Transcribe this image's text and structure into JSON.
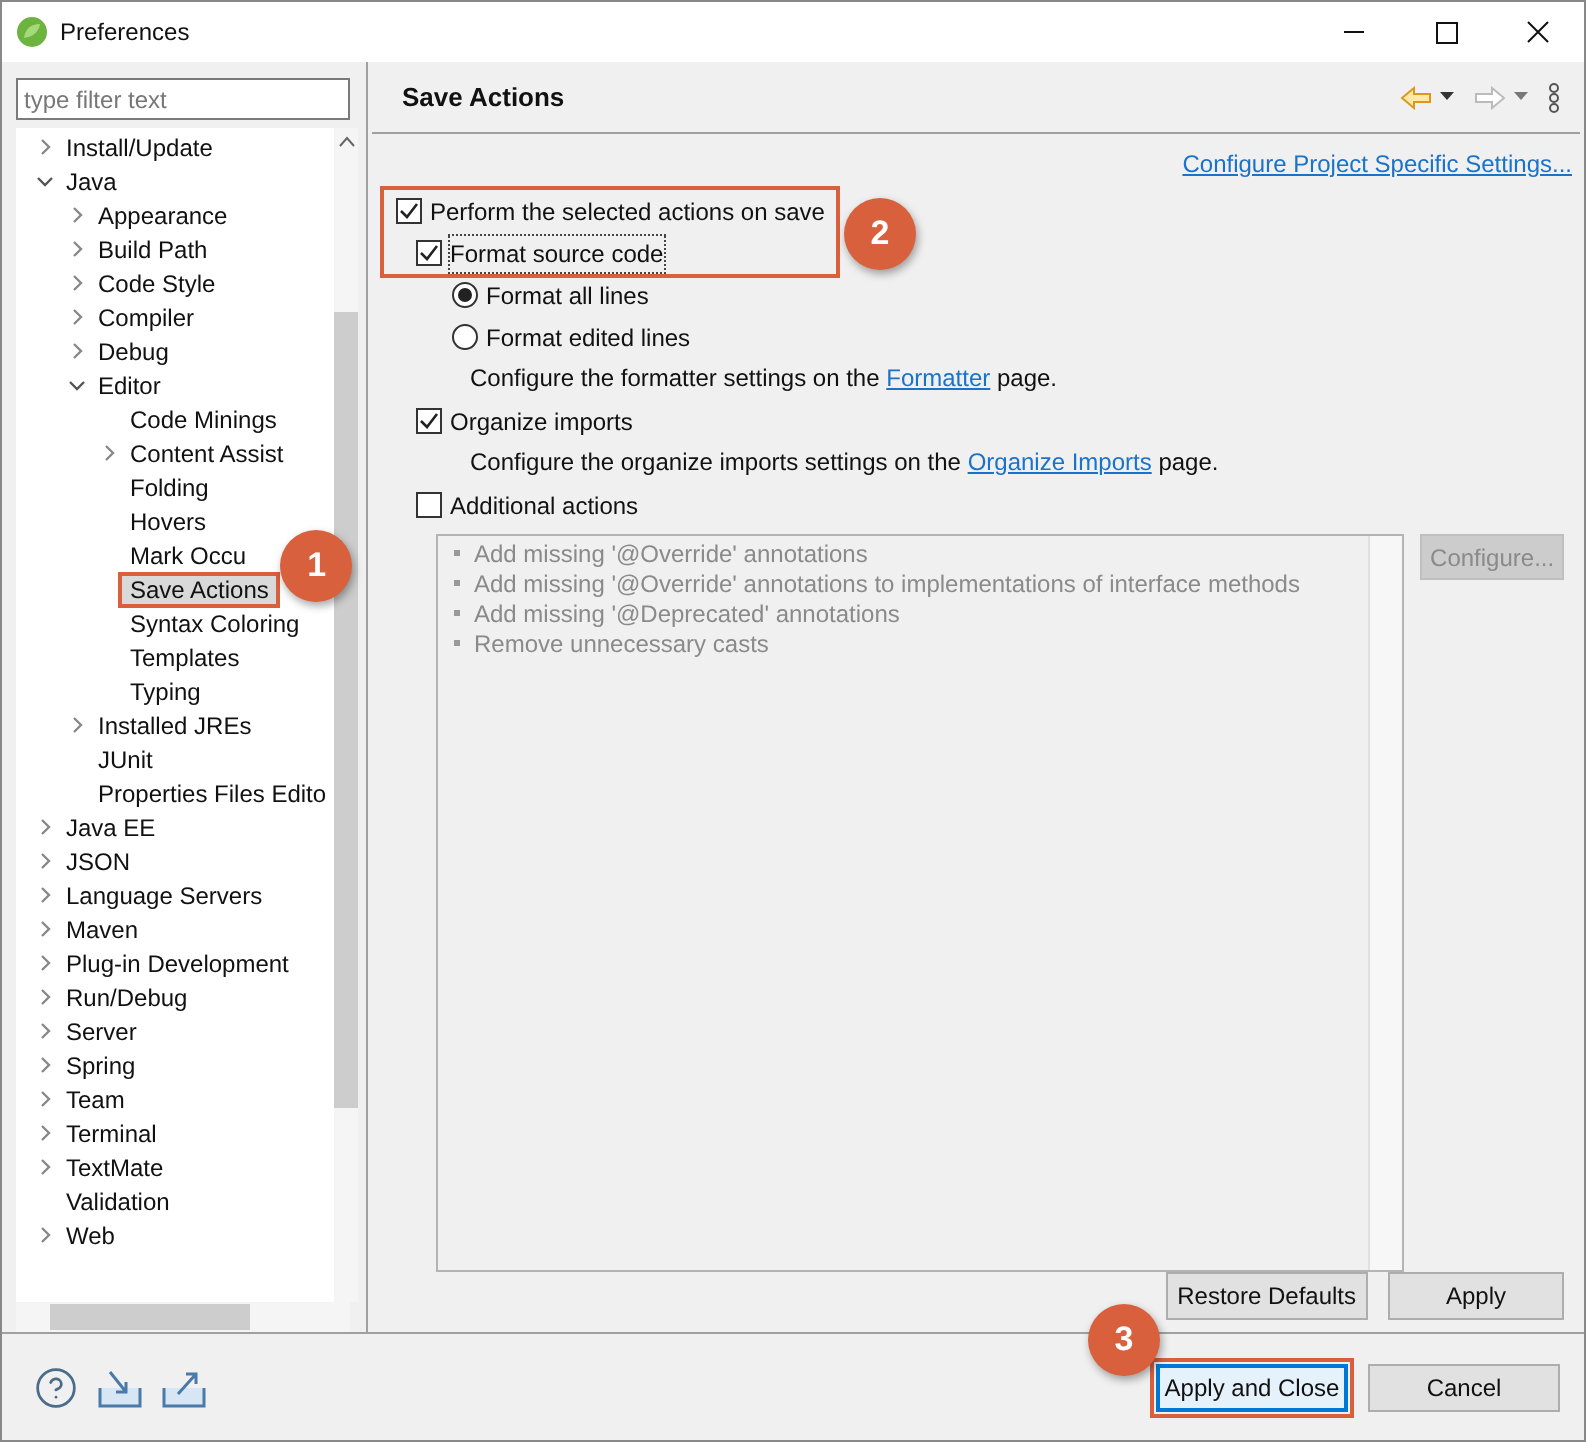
{
  "window": {
    "title": "Preferences"
  },
  "filter": {
    "placeholder": "type filter text"
  },
  "tree": [
    {
      "label": "Install/Update",
      "kind": "node",
      "expanded": false,
      "selected": false
    },
    {
      "label": "Java",
      "kind": "node",
      "expanded": true,
      "selected": false,
      "children": [
        {
          "label": "Appearance",
          "kind": "node",
          "expanded": false,
          "selected": false
        },
        {
          "label": "Build Path",
          "kind": "node",
          "expanded": false,
          "selected": false
        },
        {
          "label": "Code Style",
          "kind": "node",
          "expanded": false,
          "selected": false
        },
        {
          "label": "Compiler",
          "kind": "node",
          "expanded": false,
          "selected": false
        },
        {
          "label": "Debug",
          "kind": "node",
          "expanded": false,
          "selected": false
        },
        {
          "label": "Editor",
          "kind": "node",
          "expanded": true,
          "selected": false,
          "children": [
            {
              "label": "Code Minings",
              "kind": "leaf",
              "selected": false
            },
            {
              "label": "Content Assist",
              "kind": "node",
              "expanded": false,
              "selected": false
            },
            {
              "label": "Folding",
              "kind": "leaf",
              "selected": false
            },
            {
              "label": "Hovers",
              "kind": "leaf",
              "selected": false
            },
            {
              "label": "Mark Occu",
              "kind": "leaf",
              "selected": false
            },
            {
              "label": "Save Actions",
              "kind": "leaf",
              "selected": true,
              "callout": "1"
            },
            {
              "label": "Syntax Coloring",
              "kind": "leaf",
              "selected": false
            },
            {
              "label": "Templates",
              "kind": "leaf",
              "selected": false
            },
            {
              "label": "Typing",
              "kind": "leaf",
              "selected": false
            }
          ]
        },
        {
          "label": "Installed JREs",
          "kind": "node",
          "expanded": false,
          "selected": false
        },
        {
          "label": "JUnit",
          "kind": "leaf",
          "selected": false
        },
        {
          "label": "Properties Files Edito",
          "kind": "leaf",
          "selected": false
        }
      ]
    },
    {
      "label": "Java EE",
      "kind": "node",
      "expanded": false,
      "selected": false
    },
    {
      "label": "JSON",
      "kind": "node",
      "expanded": false,
      "selected": false
    },
    {
      "label": "Language Servers",
      "kind": "node",
      "expanded": false,
      "selected": false
    },
    {
      "label": "Maven",
      "kind": "node",
      "expanded": false,
      "selected": false
    },
    {
      "label": "Plug-in Development",
      "kind": "node",
      "expanded": false,
      "selected": false
    },
    {
      "label": "Run/Debug",
      "kind": "node",
      "expanded": false,
      "selected": false
    },
    {
      "label": "Server",
      "kind": "node",
      "expanded": false,
      "selected": false
    },
    {
      "label": "Spring",
      "kind": "node",
      "expanded": false,
      "selected": false
    },
    {
      "label": "Team",
      "kind": "node",
      "expanded": false,
      "selected": false
    },
    {
      "label": "Terminal",
      "kind": "node",
      "expanded": false,
      "selected": false
    },
    {
      "label": "TextMate",
      "kind": "node",
      "expanded": false,
      "selected": false
    },
    {
      "label": "Validation",
      "kind": "leaf",
      "selected": false
    },
    {
      "label": "Web",
      "kind": "node",
      "expanded": false,
      "selected": false
    }
  ],
  "page": {
    "title": "Save Actions",
    "link": "Configure Project Specific Settings...",
    "perform": {
      "label": "Perform the selected actions on save",
      "checked": true,
      "callout": "2"
    },
    "format_source": {
      "label": "Format source code",
      "checked": true
    },
    "format_modes": [
      {
        "label": "Format all lines",
        "selected": true
      },
      {
        "label": "Format edited lines",
        "selected": false
      }
    ],
    "formatter_note": {
      "before": "Configure the formatter settings on the ",
      "link": "Formatter",
      "after": " page."
    },
    "organize": {
      "label": "Organize imports",
      "checked": true
    },
    "organize_note": {
      "before": "Configure the organize imports settings on the ",
      "link": "Organize Imports",
      "after": " page."
    },
    "additional": {
      "label": "Additional actions",
      "checked": false,
      "items": [
        "Add missing '@Override' annotations",
        "Add missing '@Override' annotations to implementations of interface methods",
        "Add missing '@Deprecated' annotations",
        "Remove unnecessary casts"
      ]
    },
    "configure_button": {
      "label": "Configure...",
      "disabled": true
    },
    "restore_defaults": "Restore Defaults",
    "apply": "Apply"
  },
  "footer": {
    "apply_close": {
      "label": "Apply and Close",
      "callout": "3"
    },
    "cancel": "Cancel"
  }
}
